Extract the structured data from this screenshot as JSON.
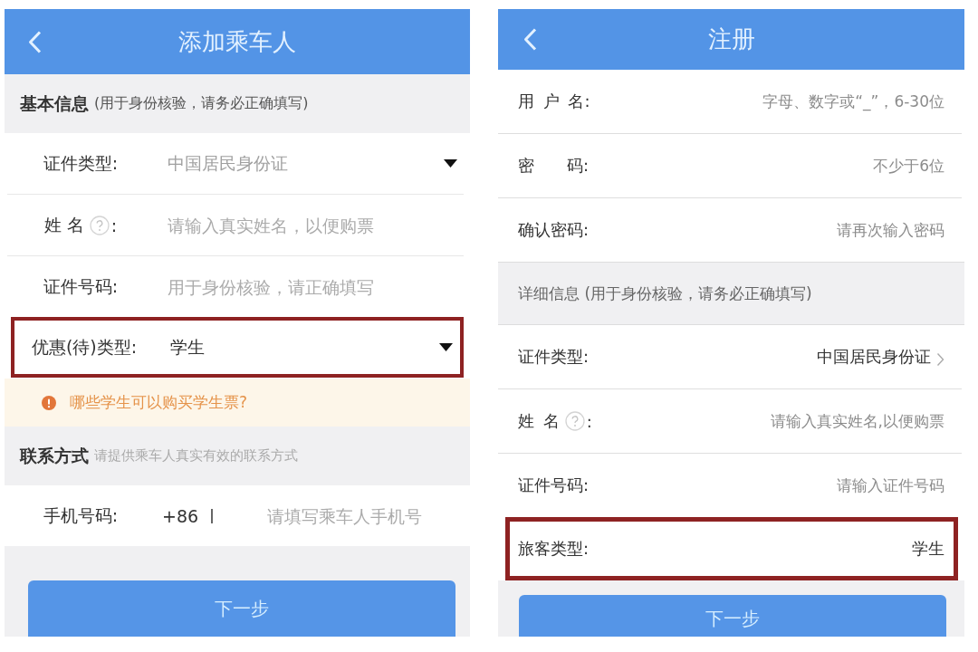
{
  "add_passenger_screen": {
    "title": "添加乘车人",
    "sections": [
      {
        "heading": "基本信息",
        "note": "(用于身份核验，请务必正确填写)",
        "muted_note": false,
        "rows": [
          {
            "kind": "select",
            "label": "证件类型:",
            "value": "中国居民身份证",
            "disabled": true,
            "highlighted": false
          },
          {
            "kind": "input",
            "label": "姓 名",
            "help_icon": true,
            "label_end": ":",
            "placeholder": "请输入真实姓名，以便购票",
            "disabled": false,
            "highlighted": false
          },
          {
            "kind": "input",
            "label": "证件号码:",
            "placeholder": "用于身份核验，请正确填写",
            "disabled": false,
            "highlighted": false
          },
          {
            "kind": "select",
            "label": "优惠(待)类型:",
            "value": "学生",
            "disabled": false,
            "highlighted": true
          }
        ],
        "notice": {
          "text": "哪些学生可以购买学生票?"
        }
      },
      {
        "heading": "联系方式",
        "note": "请提供乘车人真实有效的联系方式",
        "muted_note": true,
        "rows": [
          {
            "kind": "phone",
            "label": "手机号码:",
            "prefix": "+86",
            "placeholder": "请填写乘车人手机号",
            "disabled": false,
            "highlighted": false
          }
        ]
      }
    ],
    "button": "下一步"
  },
  "register_screen": {
    "title": "注册",
    "groups": [
      {
        "rows": [
          {
            "kind": "input",
            "label": "用 户 名:",
            "placeholder": "字母、数字或“_”，6-30位",
            "highlighted": false
          },
          {
            "kind": "input",
            "label": "密　　码:",
            "placeholder": "不少于6位",
            "highlighted": false
          },
          {
            "kind": "input",
            "label": "确认密码:",
            "placeholder": "请再次输入密码",
            "highlighted": false
          }
        ]
      },
      {
        "heading": "详细信息 (用于身份核验，请务必正确填写)",
        "rows": [
          {
            "kind": "picker",
            "label": "证件类型:",
            "value": "中国居民身份证",
            "highlighted": false
          },
          {
            "kind": "input",
            "label": "姓 名",
            "help_icon": true,
            "label_end": ":",
            "placeholder": "请输入真实姓名,以便购票",
            "highlighted": false
          },
          {
            "kind": "input",
            "label": "证件号码:",
            "placeholder": "请输入证件号码",
            "highlighted": false
          },
          {
            "kind": "value",
            "label": "旅客类型:",
            "value": "学生",
            "highlighted": true
          }
        ]
      }
    ],
    "button": "下一步"
  }
}
